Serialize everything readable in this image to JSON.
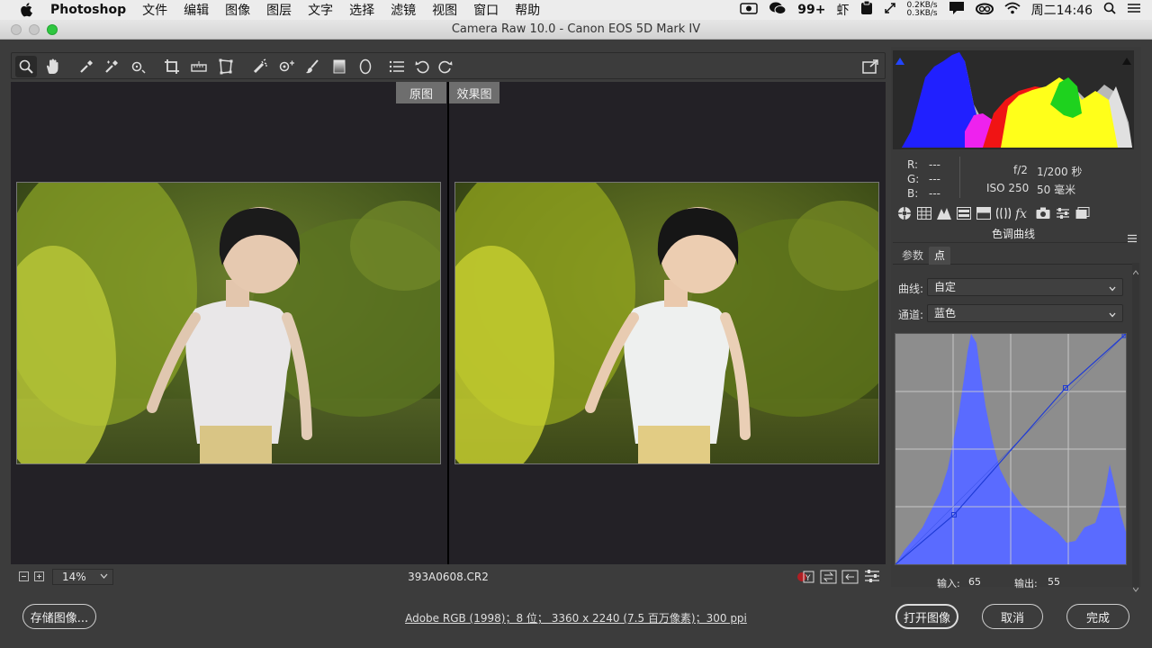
{
  "menubar": {
    "app_name": "Photoshop",
    "items": [
      "文件",
      "编辑",
      "图像",
      "图层",
      "文字",
      "选择",
      "滤镜",
      "视图",
      "窗口",
      "帮助"
    ],
    "status": {
      "badge": "99+",
      "shrimp_icon_text": "虾",
      "net_up": "0.2KB/s",
      "net_down": "0.3KB/s",
      "clock": "周二14:46"
    }
  },
  "window": {
    "title": "Camera Raw 10.0 -  Canon EOS 5D Mark IV"
  },
  "preview": {
    "label_before": "原图",
    "label_after": "效果图",
    "zoom": "14%",
    "filename": "393A0608.CR2"
  },
  "panel": {
    "readout": {
      "r_label": "R:",
      "r_value": "---",
      "g_label": "G:",
      "g_value": "---",
      "b_label": "B:",
      "b_value": "---",
      "aperture": "f/2",
      "shutter": "1/200 秒",
      "iso": "ISO 250",
      "focal": "50 毫米"
    },
    "section_title": "色调曲线",
    "tabs": [
      "参数",
      "点"
    ],
    "curve_label": "曲线:",
    "curve_value": "自定",
    "channel_label": "通道:",
    "channel_value": "蓝色",
    "input_label": "输入:",
    "input_value": "65",
    "output_label": "输出:",
    "output_value": "55"
  },
  "footer": {
    "save_label": "存储图像...",
    "info_link": "Adobe RGB (1998)；8 位；  3360 x 2240 (7.5 百万像素)；300 ppi",
    "open_label": "打开图像",
    "cancel_label": "取消",
    "done_label": "完成"
  },
  "colors": {
    "accent_blue": "#5a6bff",
    "curve_line": "#1f3bd6"
  }
}
